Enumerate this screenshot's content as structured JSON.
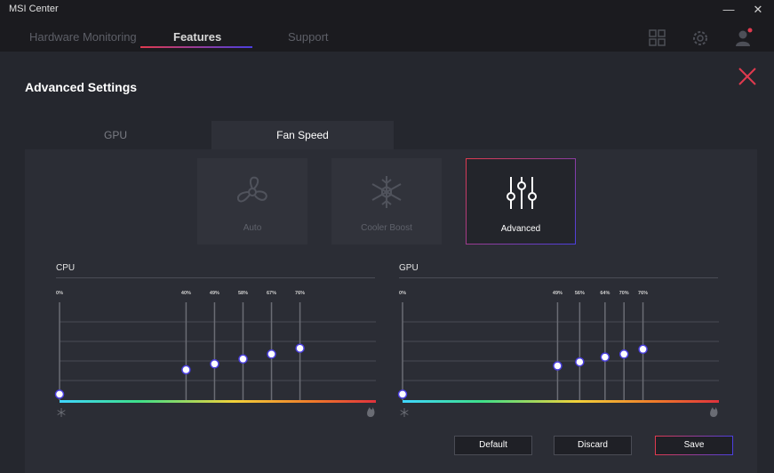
{
  "window": {
    "title": "MSI Center",
    "minimize": "—",
    "close": "✕"
  },
  "nav": {
    "tabs": [
      "Hardware Monitoring",
      "Features",
      "Support"
    ],
    "active": 1
  },
  "page": {
    "title": "Advanced Settings"
  },
  "subtabs": {
    "gpu": "GPU",
    "fan": "Fan Speed"
  },
  "modes": {
    "auto": "Auto",
    "cooler_boost": "Cooler Boost",
    "advanced": "Advanced"
  },
  "charts": [
    {
      "title": "CPU",
      "points": [
        0,
        40,
        49,
        58,
        67,
        76
      ],
      "levels": [
        0.06,
        0.31,
        0.37,
        0.42,
        0.47,
        0.53
      ]
    },
    {
      "title": "GPU",
      "points": [
        0,
        49,
        56,
        64,
        70,
        76
      ],
      "levels": [
        0.06,
        0.35,
        0.39,
        0.44,
        0.47,
        0.52
      ]
    }
  ],
  "buttons": {
    "default": "Default",
    "discard": "Discard",
    "save": "Save"
  },
  "colors": {
    "accent_red": "#e03a4e",
    "accent_blue": "#4b3fe0"
  }
}
